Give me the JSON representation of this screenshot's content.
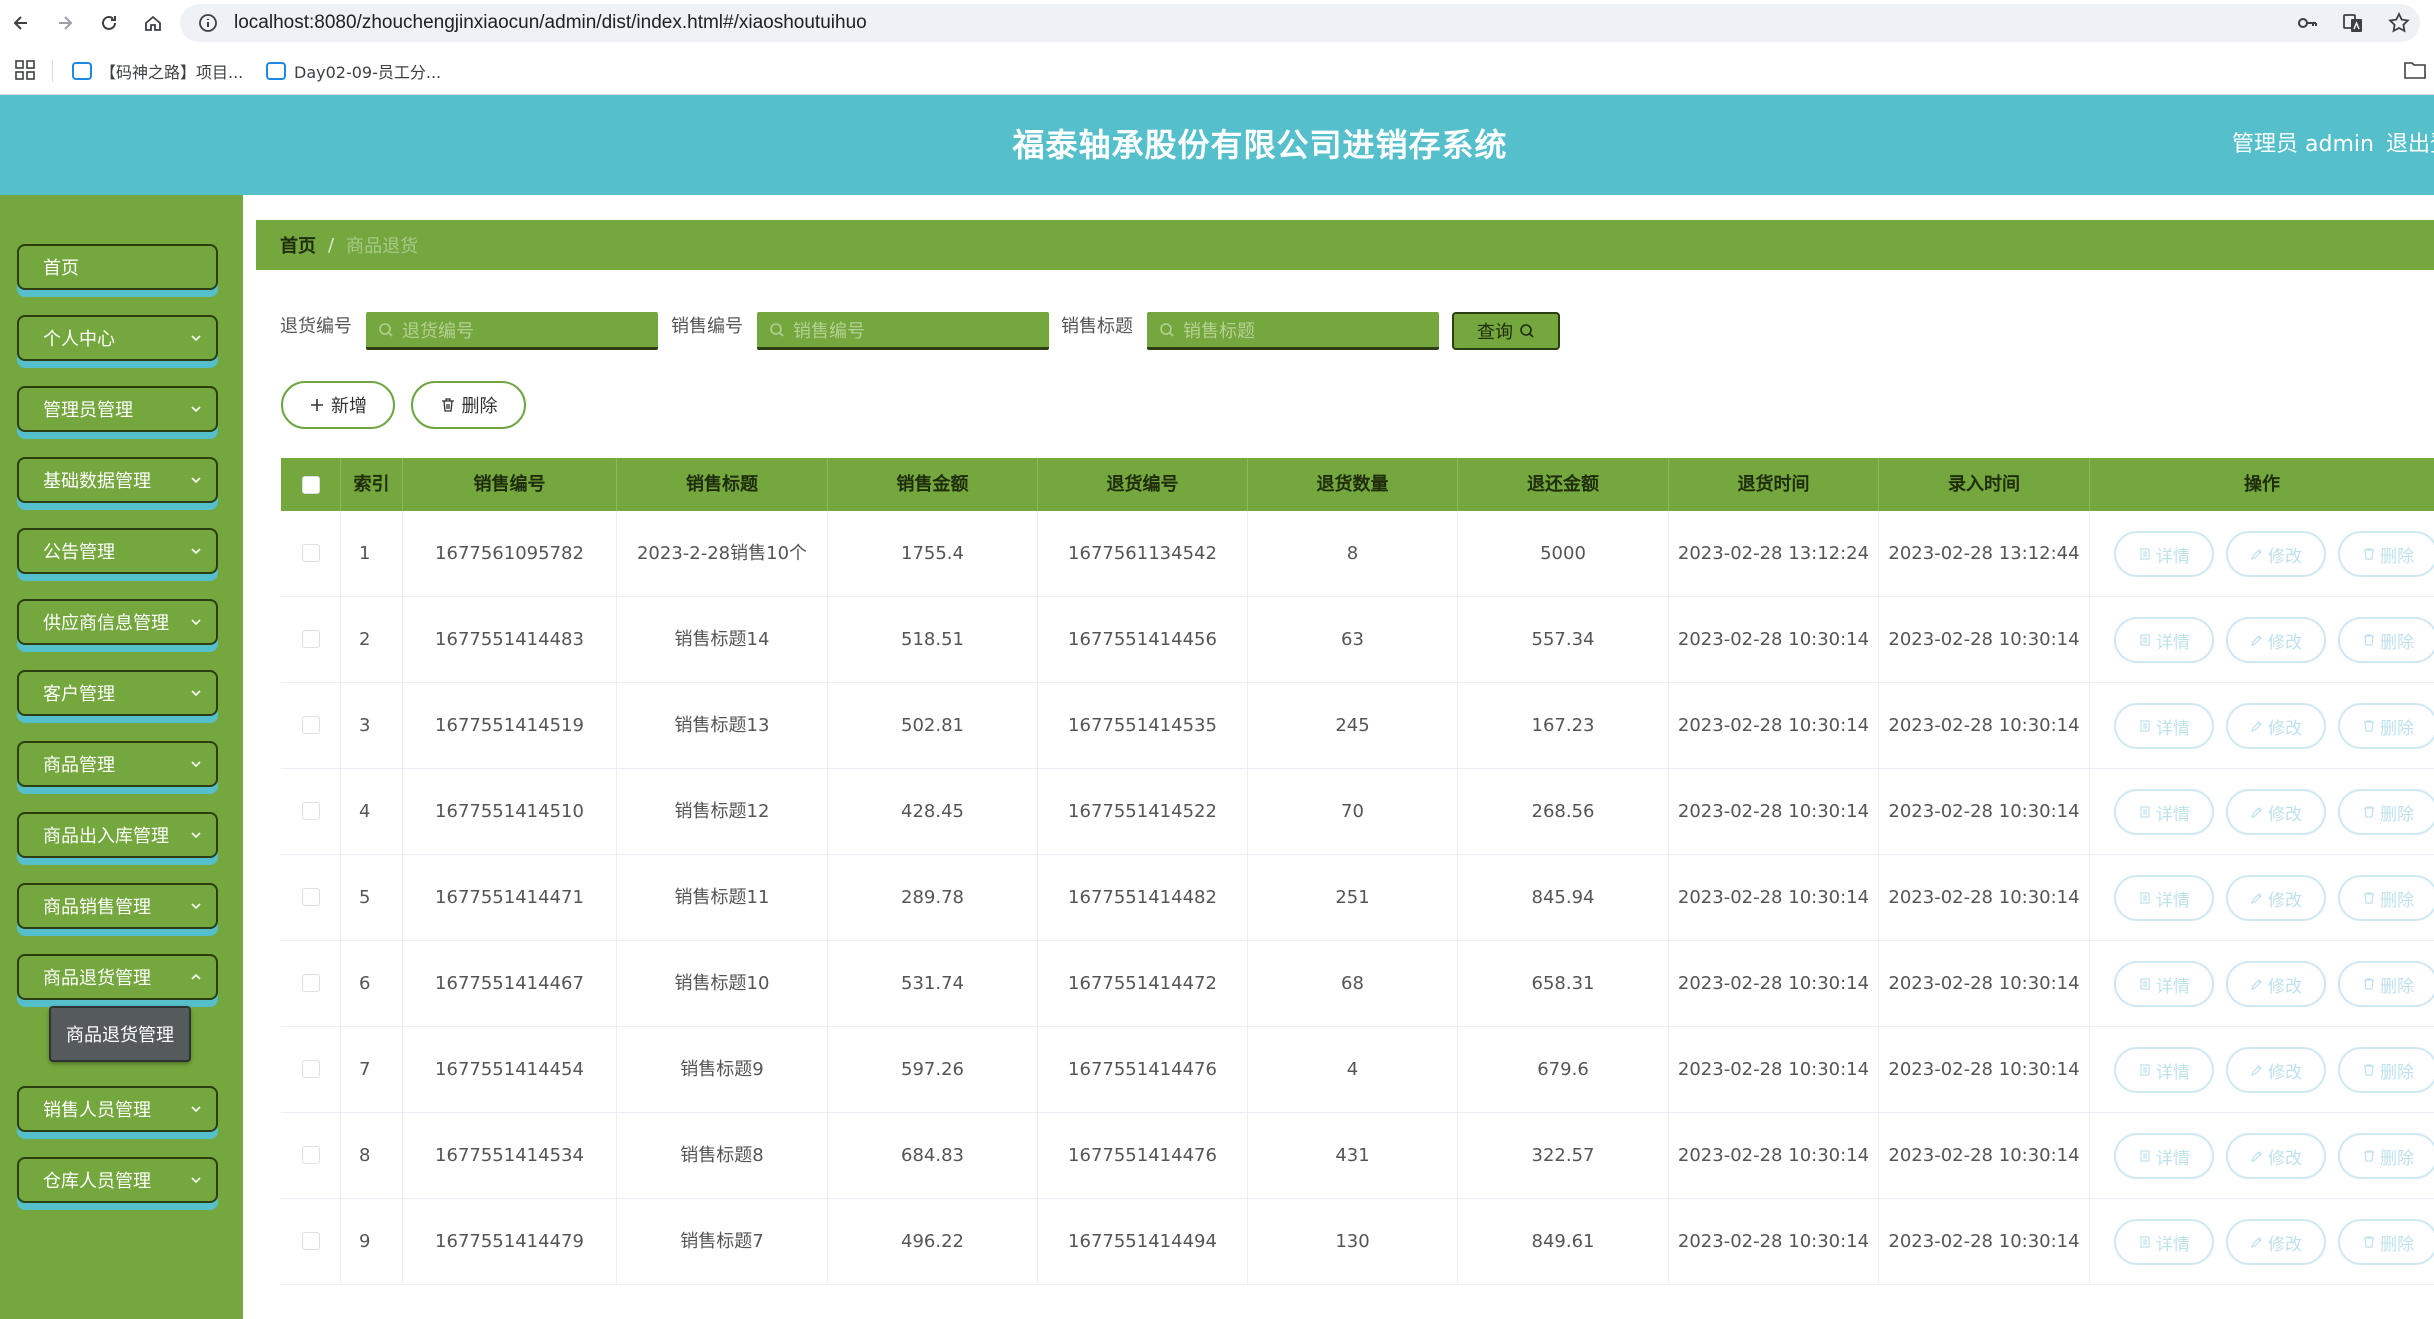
{
  "browser": {
    "url": "localhost:8080/zhouchengjinxiaocun/admin/dist/index.html#/xiaoshoutuihuo",
    "bookmarks": [
      {
        "label": "【码神之路】项目..."
      },
      {
        "label": "Day02-09-员工分..."
      }
    ]
  },
  "header": {
    "title": "福泰轴承股份有限公司进销存系统",
    "admin_label": "管理员 admin",
    "logout_label": "退出登"
  },
  "sidebar": {
    "items": [
      {
        "label": "首页"
      },
      {
        "label": "个人中心"
      },
      {
        "label": "管理员管理"
      },
      {
        "label": "基础数据管理"
      },
      {
        "label": "公告管理"
      },
      {
        "label": "供应商信息管理"
      },
      {
        "label": "客户管理"
      },
      {
        "label": "商品管理"
      },
      {
        "label": "商品出入库管理"
      },
      {
        "label": "商品销售管理"
      },
      {
        "label": "商品退货管理"
      },
      {
        "label": "销售人员管理"
      },
      {
        "label": "仓库人员管理"
      }
    ],
    "submenu_label": "商品退货管理"
  },
  "breadcrumb": {
    "home": "首页",
    "separator": "/",
    "current": "商品退货"
  },
  "search": {
    "fields": [
      {
        "label": "退货编号",
        "placeholder": "退货编号"
      },
      {
        "label": "销售编号",
        "placeholder": "销售编号"
      },
      {
        "label": "销售标题",
        "placeholder": "销售标题"
      }
    ],
    "query_label": "查询"
  },
  "actions": {
    "add_label": "新增",
    "delete_label": "删除"
  },
  "table": {
    "headers": [
      "索引",
      "销售编号",
      "销售标题",
      "销售金额",
      "退货编号",
      "退货数量",
      "退还金额",
      "退货时间",
      "录入时间",
      "操作"
    ],
    "op_labels": {
      "detail": "详情",
      "edit": "修改",
      "delete": "删除"
    },
    "rows": [
      [
        "1",
        "1677561095782",
        "2023-2-28销售10个",
        "1755.4",
        "1677561134542",
        "8",
        "5000",
        "2023-02-28 13:12:24",
        "2023-02-28 13:12:44"
      ],
      [
        "2",
        "1677551414483",
        "销售标题14",
        "518.51",
        "1677551414456",
        "63",
        "557.34",
        "2023-02-28 10:30:14",
        "2023-02-28 10:30:14"
      ],
      [
        "3",
        "1677551414519",
        "销售标题13",
        "502.81",
        "1677551414535",
        "245",
        "167.23",
        "2023-02-28 10:30:14",
        "2023-02-28 10:30:14"
      ],
      [
        "4",
        "1677551414510",
        "销售标题12",
        "428.45",
        "1677551414522",
        "70",
        "268.56",
        "2023-02-28 10:30:14",
        "2023-02-28 10:30:14"
      ],
      [
        "5",
        "1677551414471",
        "销售标题11",
        "289.78",
        "1677551414482",
        "251",
        "845.94",
        "2023-02-28 10:30:14",
        "2023-02-28 10:30:14"
      ],
      [
        "6",
        "1677551414467",
        "销售标题10",
        "531.74",
        "1677551414472",
        "68",
        "658.31",
        "2023-02-28 10:30:14",
        "2023-02-28 10:30:14"
      ],
      [
        "7",
        "1677551414454",
        "销售标题9",
        "597.26",
        "1677551414476",
        "4",
        "679.6",
        "2023-02-28 10:30:14",
        "2023-02-28 10:30:14"
      ],
      [
        "8",
        "1677551414534",
        "销售标题8",
        "684.83",
        "1677551414476",
        "431",
        "322.57",
        "2023-02-28 10:30:14",
        "2023-02-28 10:30:14"
      ],
      [
        "9",
        "1677551414479",
        "销售标题7",
        "496.22",
        "1677551414494",
        "130",
        "849.61",
        "2023-02-28 10:30:14",
        "2023-02-28 10:30:14"
      ]
    ]
  },
  "colors": {
    "header": "#55c0cc",
    "sidebar": "#74a73d",
    "accent_dark": "#2c3e11",
    "op_button": "#bfe1ee"
  }
}
